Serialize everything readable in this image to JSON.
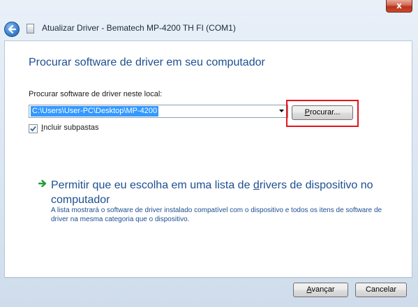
{
  "window": {
    "title": "Atualizar Driver - Bematech MP-4200 TH FI (COM1)",
    "close_label": "x"
  },
  "main": {
    "heading": "Procurar software de driver em seu computador",
    "path_label": "Procurar software de driver neste local:",
    "path_value": "C:\\Users\\User-PC\\Desktop\\MP-4200",
    "browse_prefix": "P",
    "browse_rest": "rocurar...",
    "include_prefix": "I",
    "include_rest": "ncluir subpastas",
    "include_checked": true,
    "link_part1": "Permitir que eu escolha em uma lista de ",
    "link_underlined": "d",
    "link_part2": "rivers de dispositivo no computador",
    "link_description": "A lista mostrará o software de driver instalado compatível com o dispositivo e todos os itens de software de driver na mesma categoria que o dispositivo."
  },
  "footer": {
    "next_prefix": "A",
    "next_rest": "vançar",
    "cancel_label": "Cancelar"
  },
  "colors": {
    "heading": "#1e4f91",
    "selection": "#3399ff",
    "highlight": "#e3151b",
    "arrow": "#1f9e3a"
  },
  "icons": [
    "back-arrow-icon",
    "device-icon",
    "close-icon",
    "dropdown-arrow-icon",
    "checkmark-icon",
    "green-arrow-icon"
  ]
}
